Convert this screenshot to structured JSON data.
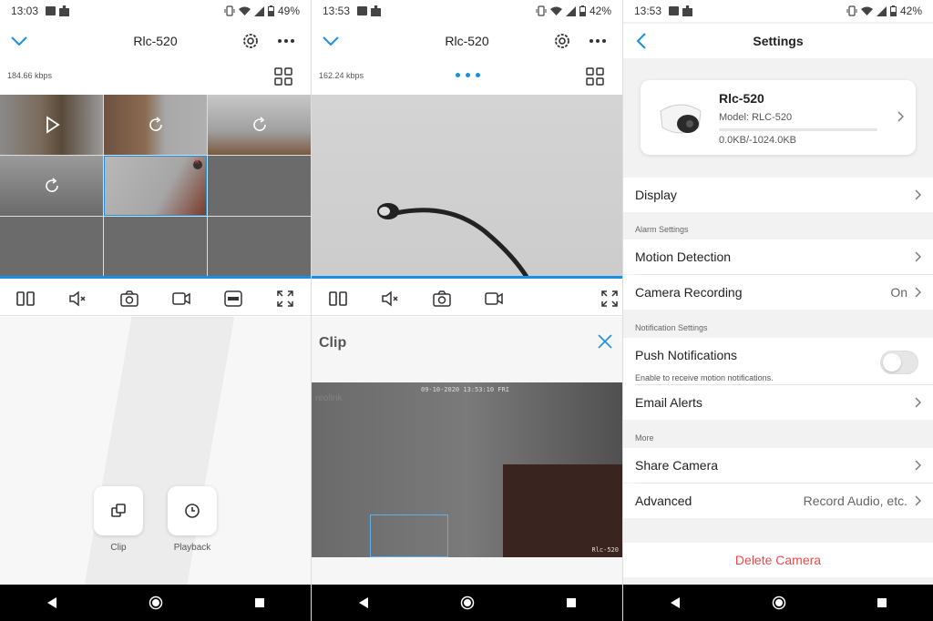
{
  "panel1": {
    "status": {
      "time": "13:03",
      "battery": "49%"
    },
    "title": "Rlc-520",
    "bitrate": "184.66 kbps",
    "actions": [
      {
        "label": "Clip",
        "icon": "clip-icon"
      },
      {
        "label": "Playback",
        "icon": "clock-icon"
      }
    ]
  },
  "panel2": {
    "status": {
      "time": "13:53",
      "battery": "42%"
    },
    "title": "Rlc-520",
    "bitrate": "162.24 kbps",
    "clip": {
      "title": "Clip",
      "timestamp": "09-10-2020 13:53:10 FRI",
      "watermark": "reolink",
      "camera_label": "Rlc-520"
    }
  },
  "panel3": {
    "status": {
      "time": "13:53",
      "battery": "42%"
    },
    "title": "Settings",
    "device": {
      "name": "Rlc-520",
      "model": "Model: RLC-520",
      "usage": "0.0KB/-1024.0KB"
    },
    "rows": {
      "display": "Display",
      "alarm_header": "Alarm Settings",
      "motion": "Motion Detection",
      "recording": "Camera Recording",
      "recording_value": "On",
      "notif_header": "Notification Settings",
      "push": "Push Notifications",
      "push_sub": "Enable to receive motion notifications.",
      "email": "Email Alerts",
      "more_header": "More",
      "share": "Share Camera",
      "advanced": "Advanced",
      "advanced_value": "Record Audio, etc.",
      "delete": "Delete Camera"
    }
  },
  "colors": {
    "accent": "#1a8fe3",
    "danger": "#e84a4a"
  }
}
